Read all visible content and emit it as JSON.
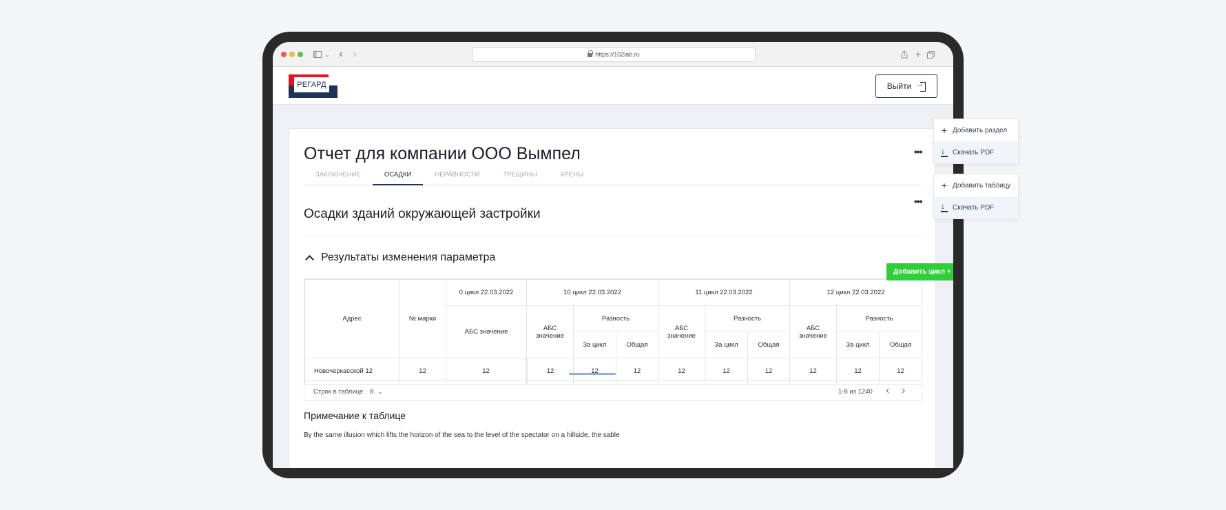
{
  "browser": {
    "url": "https://102lab.ru"
  },
  "header": {
    "logo_text": "РЕГАРД",
    "logout_label": "Выйти"
  },
  "report": {
    "title": "Отчет для компании ООО Вымпел",
    "tabs": [
      {
        "label": "ЗАКЛЮЧЕНИЕ",
        "active": false
      },
      {
        "label": "ОСАДКИ",
        "active": true
      },
      {
        "label": "НЕРАВНОСТИ",
        "active": false
      },
      {
        "label": "ТРЕЩИНЫ",
        "active": false
      },
      {
        "label": "КРЕНЫ",
        "active": false
      }
    ],
    "section_title": "Осадки зданий окружающей застройки",
    "subsection_title": "Результаты изменения параметра",
    "add_cycle_label": "Добавить цикл +"
  },
  "table": {
    "col_address": "Адрес",
    "col_mark": "№ марки",
    "cycles": [
      "0 цикл 22.03.2022",
      "10 цикл 22.03.2022",
      "11 цикл 22.03.2022",
      "12 цикл 22.03.2022"
    ],
    "abs_value": "АБС значение",
    "abs_value_short_1": "АБС",
    "abs_value_short_2": "значение",
    "difference": "Разность",
    "per_cycle": "За цикл",
    "total": "Общая",
    "rows": [
      {
        "address": "Новочеркасской 12",
        "mark": "12",
        "c0": "12",
        "c10_abs": "12",
        "c10_cycle": "12",
        "c10_total": "12",
        "c11_abs": "12",
        "c11_cycle": "12",
        "c11_total": "12",
        "c12_abs": "12",
        "c12_cycle": "12",
        "c12_total": "12"
      }
    ],
    "rows_label": "Строк в таблице",
    "rows_value": "8",
    "range": "1-8 из 1240"
  },
  "note": {
    "title": "Примечание к таблице",
    "text": "By the same illusion which lifts the horizon of the sea to the level of the spectator on a hillside, the sable"
  },
  "menus": {
    "section_menu": [
      {
        "label": "Добавить раздел",
        "icon": "plus-icon"
      },
      {
        "label": "Скачать PDF",
        "icon": "download-icon"
      }
    ],
    "table_menu": [
      {
        "label": "Добавить таблицу",
        "icon": "plus-icon"
      },
      {
        "label": "Скачать PDF",
        "icon": "download-icon"
      }
    ]
  }
}
